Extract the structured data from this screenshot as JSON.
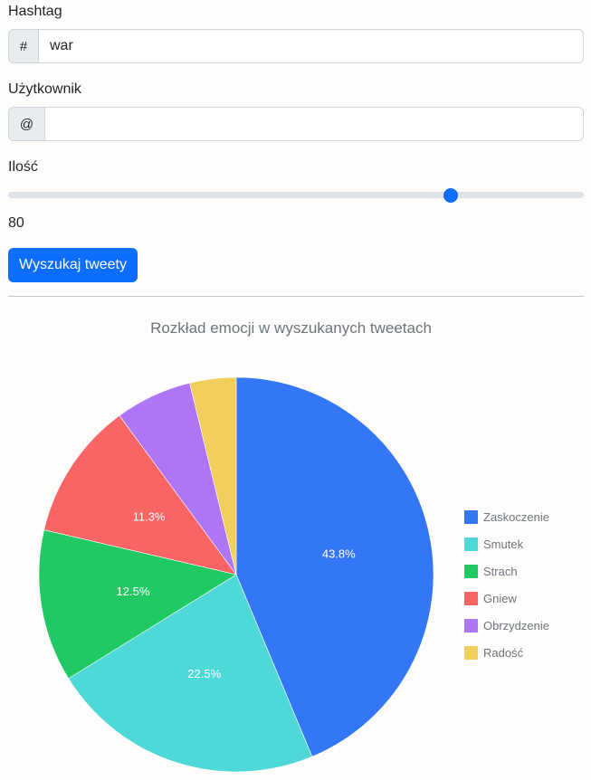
{
  "form": {
    "hashtag": {
      "label": "Hashtag",
      "prefix": "#",
      "value": "war"
    },
    "user": {
      "label": "Użytkownik",
      "prefix": "@",
      "value": ""
    },
    "count": {
      "label": "Ilość",
      "value": "80",
      "slider_fraction": 0.776
    },
    "search_button": "Wyszukaj tweety"
  },
  "chart_data": {
    "type": "pie",
    "title": "Rozkład emocji w wyszukanych tweetach",
    "legend_position": "right",
    "slices": [
      {
        "label": "Zaskoczenie",
        "value": 43.8,
        "color": "#3377f7",
        "show_label": true
      },
      {
        "label": "Smutek",
        "value": 22.5,
        "color": "#4fd8d8",
        "show_label": true
      },
      {
        "label": "Strach",
        "value": 12.5,
        "color": "#21c965",
        "show_label": true
      },
      {
        "label": "Gniew",
        "value": 11.3,
        "color": "#f96464",
        "show_label": true
      },
      {
        "label": "Obrzydzenie",
        "value": 6.3,
        "color": "#ae76f6",
        "show_label": false
      },
      {
        "label": "Radość",
        "value": 3.8,
        "color": "#f1cf5c",
        "show_label": false
      }
    ]
  }
}
